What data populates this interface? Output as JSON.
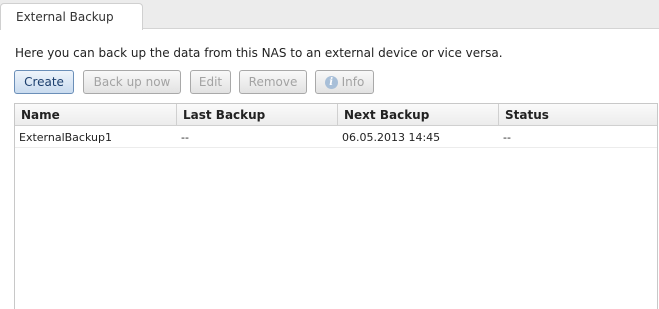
{
  "tabs": [
    {
      "label": "External Backup",
      "active": true
    }
  ],
  "description": "Here you can back up the data from this NAS to an external device or vice versa.",
  "toolbar": {
    "create_label": "Create",
    "backup_now_label": "Back up now",
    "edit_label": "Edit",
    "remove_label": "Remove",
    "info_label": "Info",
    "info_icon_glyph": "i"
  },
  "table": {
    "columns": [
      "Name",
      "Last Backup",
      "Next Backup",
      "Status"
    ],
    "rows": [
      [
        "ExternalBackup1",
        "--",
        "06.05.2013 14:45",
        "--"
      ]
    ]
  },
  "colors": {
    "primary_button_text": "#1c3f6e",
    "disabled_button_text": "#a3a3a3",
    "info_icon": "#a8bfd8"
  }
}
